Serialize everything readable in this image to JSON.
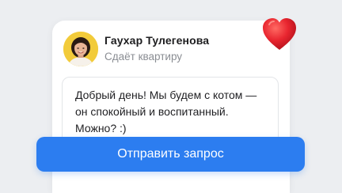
{
  "profile": {
    "name": "Гаухар Тулегенова",
    "status": "Сдаёт квартиру"
  },
  "message": {
    "text": "Добрый день! Мы будем с котом — он спокойный и воспитанный. Можно? :)"
  },
  "actions": {
    "send_label": "Отправить запрос"
  },
  "icons": {
    "heart": "heart-icon",
    "avatar": "avatar"
  },
  "colors": {
    "accent": "#2c7df0",
    "heart": "#e8252f",
    "avatar_bg": "#f2cb3a"
  }
}
